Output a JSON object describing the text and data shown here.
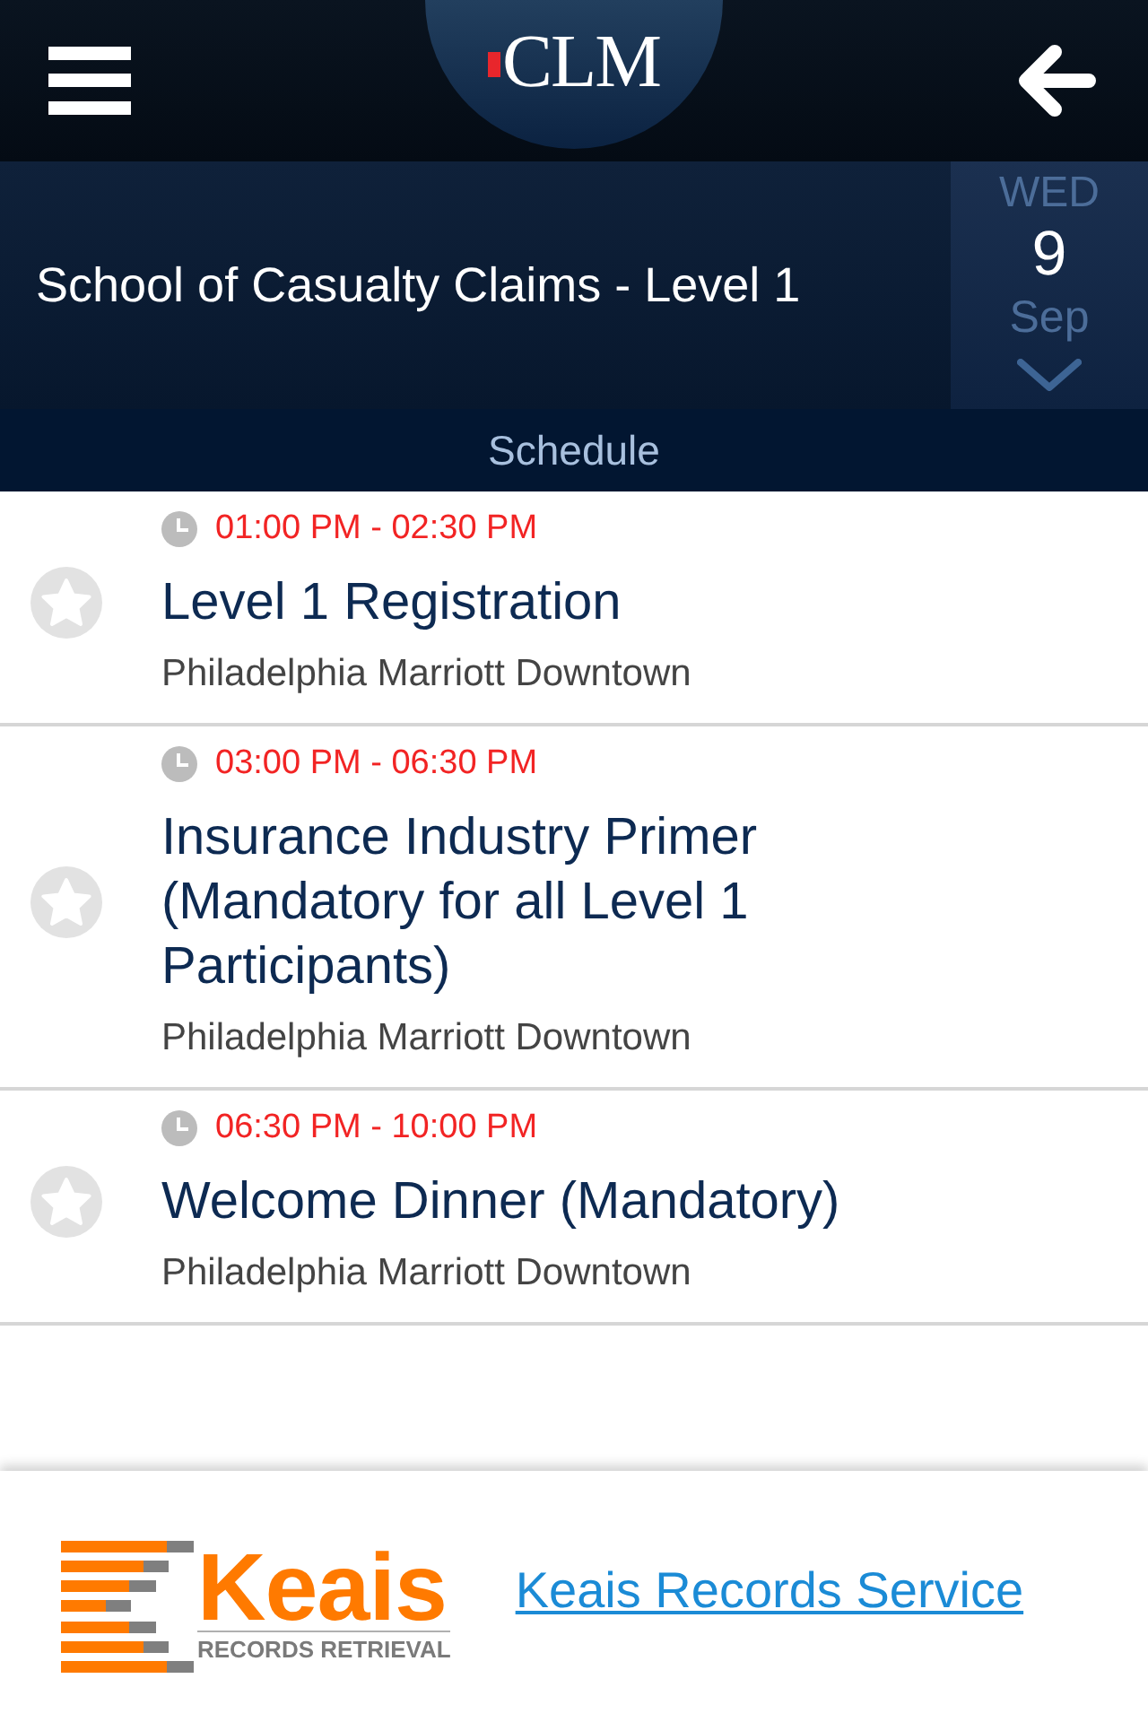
{
  "top_bar": {
    "logo": "CLM"
  },
  "course": {
    "title": "School of Casualty Claims - Level 1",
    "date": {
      "weekday": "WED",
      "day": "9",
      "month": "Sep"
    }
  },
  "section_title": "Schedule",
  "sessions": [
    {
      "time": "01:00 PM - 02:30 PM",
      "title": "Level 1 Registration",
      "location": "Philadelphia Marriott Downtown",
      "starred": false
    },
    {
      "time": "03:00 PM - 06:30 PM",
      "title": "Insurance Industry Primer (Mandatory for all Level 1 Participants)",
      "location": "Philadelphia Marriott Downtown",
      "starred": false
    },
    {
      "time": "06:30 PM - 10:00 PM",
      "title": "Welcome Dinner (Mandatory)",
      "location": "Philadelphia Marriott Downtown",
      "starred": false
    }
  ],
  "footer": {
    "logo": {
      "name": "Keais",
      "tagline": "RECORDS RETRIEVAL"
    },
    "link": "Keais Records Service"
  }
}
